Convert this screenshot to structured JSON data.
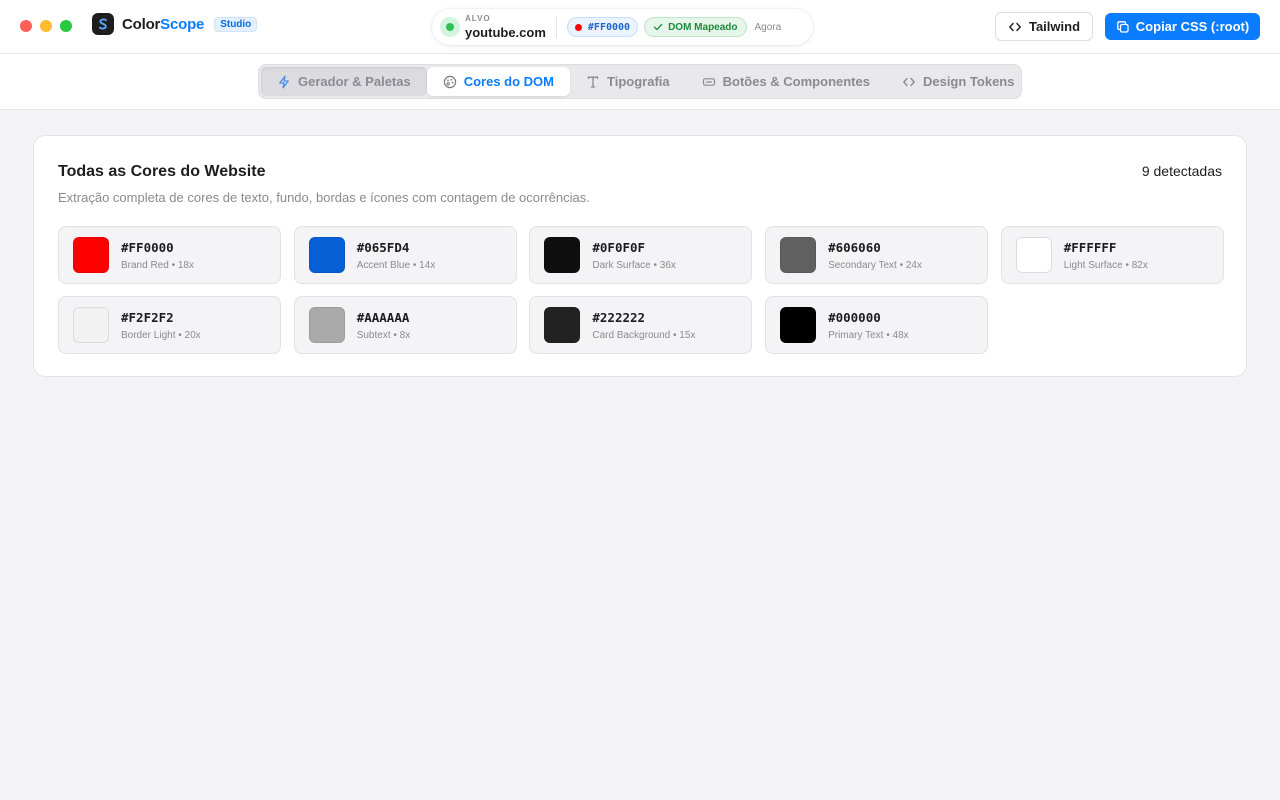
{
  "app": {
    "name_part1": "Color",
    "name_part2": "Scope",
    "tag": "Studio"
  },
  "target": {
    "label": "ALVO",
    "domain": "youtube.com",
    "hex": "#FF0000",
    "dom_status": "DOM Mapeado",
    "time": "Agora"
  },
  "actions": {
    "tailwind_label": "Tailwind",
    "copy_label": "Copiar CSS (:root)"
  },
  "tabs": [
    {
      "label": "Gerador & Paletas",
      "icon": "bolt-icon"
    },
    {
      "label": "Cores do DOM",
      "icon": "palette-icon"
    },
    {
      "label": "Tipografia",
      "icon": "type-icon"
    },
    {
      "label": "Botões & Componentes",
      "icon": "button-icon"
    },
    {
      "label": "Design Tokens",
      "icon": "code-icon"
    }
  ],
  "card": {
    "title": "Todas as Cores do Website",
    "subtitle": "Extração completa de cores de texto, fundo, bordas e ícones com contagem de ocorrências.",
    "count": "9 detectadas",
    "colors": [
      {
        "hex": "#FF0000",
        "meta": "Brand Red • 18x",
        "swatch": "#ff0000"
      },
      {
        "hex": "#065FD4",
        "meta": "Accent Blue • 14x",
        "swatch": "#065fd4"
      },
      {
        "hex": "#0F0F0F",
        "meta": "Dark Surface • 36x",
        "swatch": "#0f0f0f"
      },
      {
        "hex": "#606060",
        "meta": "Secondary Text • 24x",
        "swatch": "#606060"
      },
      {
        "hex": "#FFFFFF",
        "meta": "Light Surface • 82x",
        "swatch": "#ffffff"
      },
      {
        "hex": "#F2F2F2",
        "meta": "Border Light • 20x",
        "swatch": "#f2f2f2"
      },
      {
        "hex": "#AAAAAA",
        "meta": "Subtext • 8x",
        "swatch": "#aaaaaa"
      },
      {
        "hex": "#222222",
        "meta": "Card Background • 15x",
        "swatch": "#222222"
      },
      {
        "hex": "#000000",
        "meta": "Primary Text • 48x",
        "swatch": "#000000"
      }
    ]
  },
  "colors": {
    "accent": "#0a7cff",
    "live": "#2fbf58"
  }
}
